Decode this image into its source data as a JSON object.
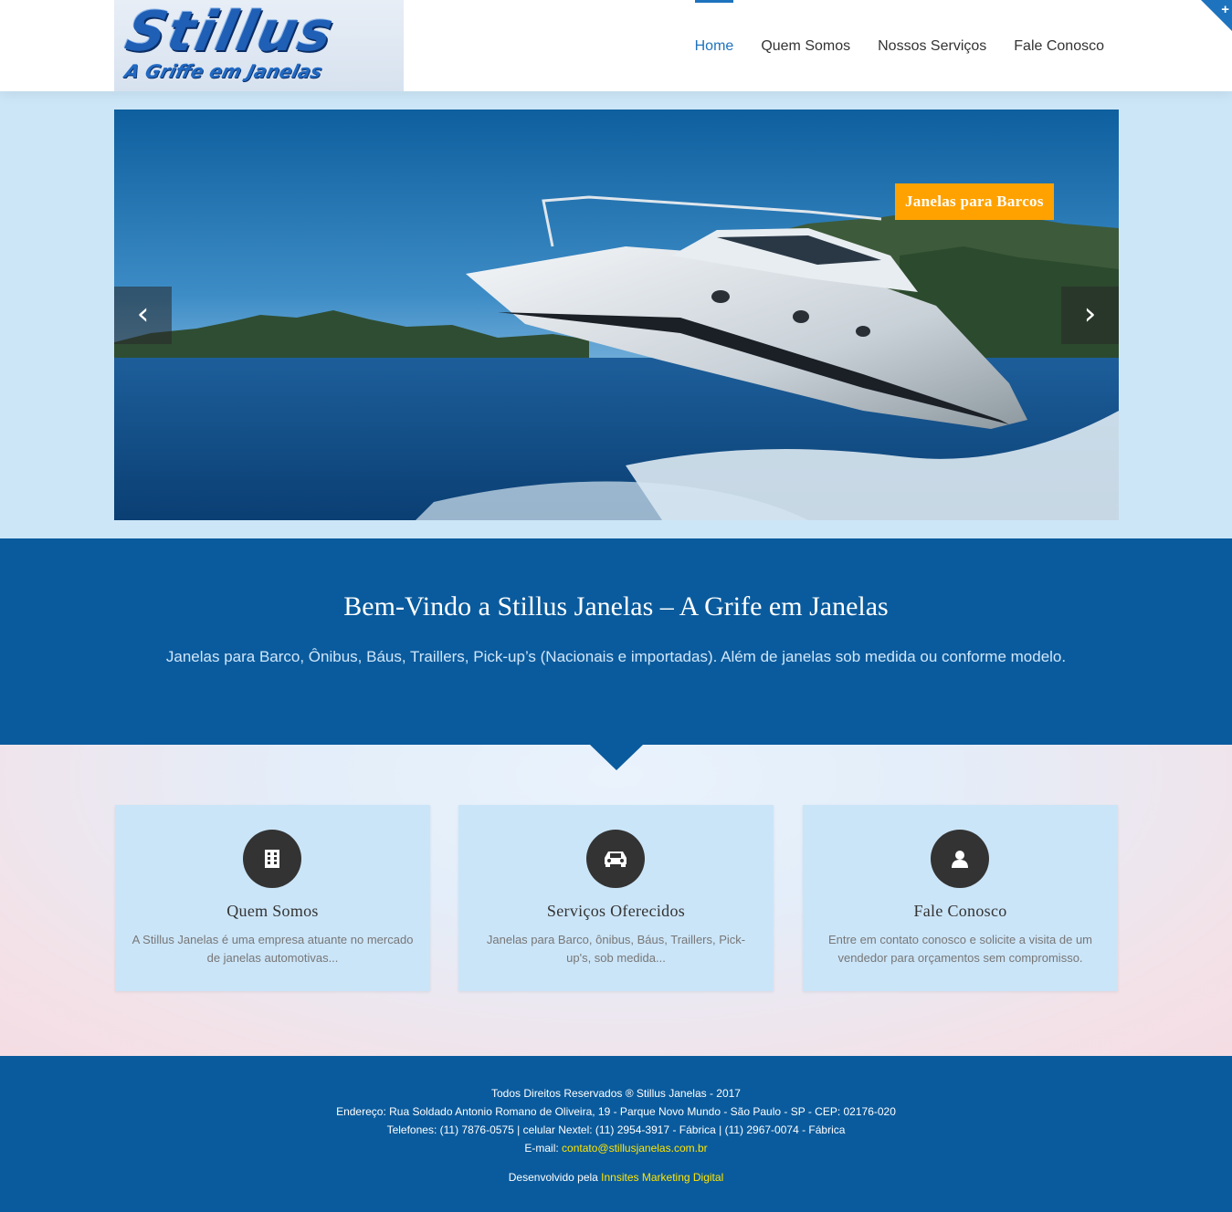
{
  "brand": {
    "logo_main": "Stillus",
    "logo_sub": "A Griffe em Janelas"
  },
  "nav": {
    "items": [
      {
        "label": "Home",
        "active": true
      },
      {
        "label": "Quem Somos",
        "active": false
      },
      {
        "label": "Nossos Serviços",
        "active": false
      },
      {
        "label": "Fale Conosco",
        "active": false
      }
    ]
  },
  "corner_toggle": {
    "icon": "plus-icon",
    "label": "+"
  },
  "slider": {
    "caption": "Janelas para Barcos",
    "prev_icon": "chevron-left-icon",
    "next_icon": "chevron-right-icon",
    "prev_label": "‹",
    "next_label": "›"
  },
  "welcome": {
    "title": "Bem-Vindo a Stillus Janelas – A Grife em Janelas",
    "subtitle": "Janelas para Barco, Ônibus, Báus, Traillers, Pick-up’s (Nacionais e importadas). Além de janelas sob medida ou conforme modelo."
  },
  "features": [
    {
      "icon": "building-icon",
      "title": "Quem Somos",
      "text": "A Stillus Janelas é uma empresa atuante no mercado de janelas automotivas..."
    },
    {
      "icon": "car-icon",
      "title": "Serviços Oferecidos",
      "text": "Janelas para Barco, ônibus, Báus, Traillers, Pick-up's, sob medida..."
    },
    {
      "icon": "user-icon",
      "title": "Fale Conosco",
      "text": "Entre em contato conosco e solicite a visita de um vendedor para orçamentos sem compromisso."
    }
  ],
  "footer": {
    "copyright": "Todos Direitos Reservados ® Stillus Janelas - 2017",
    "address": "Endereço: Rua Soldado Antonio Romano de Oliveira, 19 - Parque Novo Mundo - São Paulo - SP - CEP: 02176-020",
    "phones": "Telefones: (11) 7876-0575 | celular Nextel: (11) 2954-3917 - Fábrica | (11) 2967-0074 - Fábrica",
    "email_label": "E-mail: ",
    "email": "contato@stillusjanelas.com.br",
    "dev_label": "Desenvolvido pela ",
    "dev_name": "Innsites Marketing Digital"
  },
  "colors": {
    "accent": "#1e73be",
    "band": "#0a5b9d",
    "caption": "#ffa200",
    "card": "#cbe5f8",
    "footer_link": "#ffe500"
  }
}
